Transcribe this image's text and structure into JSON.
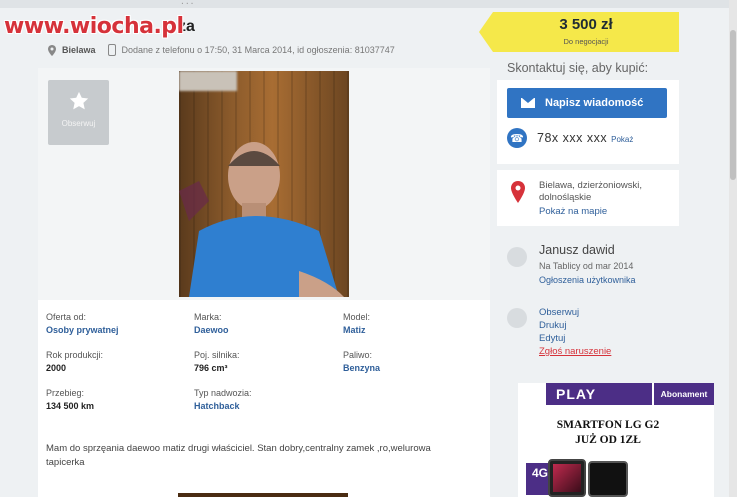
{
  "watermark": "www.wiocha.pl",
  "listing": {
    "title_partial": "za",
    "location": "Bielawa",
    "meta": "Dodane z telefonu o 17:50, 31 Marca 2014, id ogłoszenia: 81037747",
    "observe_label": "Obserwuj"
  },
  "price": {
    "amount": "3 500 zł",
    "negotiable": "Do negocjacji"
  },
  "specs": [
    {
      "key": "Oferta od:",
      "value": "Osoby prywatnej",
      "link": true
    },
    {
      "key": "Marka:",
      "value": "Daewoo",
      "link": true
    },
    {
      "key": "Model:",
      "value": "Matiz",
      "link": true
    },
    {
      "key": "Rok produkcji:",
      "value": "2000",
      "link": false
    },
    {
      "key": "Poj. silnika:",
      "value": "796 cm³",
      "link": false
    },
    {
      "key": "Paliwo:",
      "value": "Benzyna",
      "link": true
    },
    {
      "key": "Przebieg:",
      "value": "134 500 km",
      "link": false
    },
    {
      "key": "Typ nadwozia:",
      "value": "Hatchback",
      "link": true
    }
  ],
  "description": "Mam do sprzęania daewoo matiz drugi właściciel. Stan dobry,centralny zamek ,ro,welurowa tapicerka",
  "contact": {
    "heading": "Skontaktuj się, aby kupić:",
    "message_button": "Napisz wiadomość",
    "phone": "78x xxx xxx",
    "show_label": "Pokaż"
  },
  "location_box": {
    "line1": "Bielawa, dzierżoniowski,",
    "line2": "dolnośląskie",
    "map_link": "Pokaż na mapie"
  },
  "user": {
    "name": "Janusz dawid",
    "since": "Na Tablicy od mar 2014",
    "ads_link": "Ogłoszenia użytkownika"
  },
  "actions": {
    "observe": "Obserwuj",
    "print": "Drukuj",
    "edit": "Edytuj",
    "report": "Zgłoś naruszenie"
  },
  "ad": {
    "brand": "PLAY",
    "tag": "Abonament",
    "line1": "SMARTFON LG G2",
    "line2": "JUŻ OD 1ZŁ",
    "badge": "4G"
  },
  "colors": {
    "accent": "#3074c3",
    "price_bg": "#f5e84a",
    "ad_brand": "#4c2e86",
    "report": "#d6323a"
  }
}
